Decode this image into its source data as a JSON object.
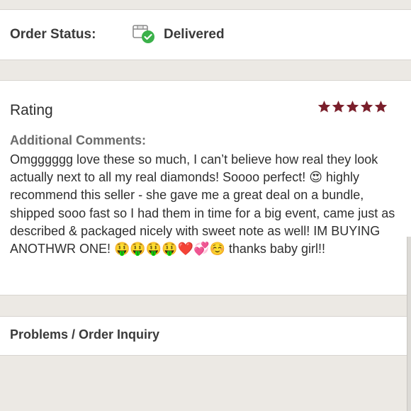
{
  "order_status": {
    "label": "Order Status:",
    "value": "Delivered",
    "icon": "package-delivered-icon",
    "check_color": "#3bb14a"
  },
  "rating": {
    "label": "Rating",
    "stars": 5,
    "star_color": "#7a1f2b"
  },
  "comments": {
    "label": "Additional Comments:",
    "text": "Omgggggg love these so much, I can’t believe how real they look actually next to all my real diamonds! Soooo perfect! 😍 highly recommend this seller - she gave me a great deal on a bundle, shipped sooo fast so I had them in time for a big event, came just as described & packaged nicely with sweet note as well! IM BUYING ANOTHWR ONE! 🤑🤑🤑🤑❤️💞☺️ thanks baby girl!!"
  },
  "problems": {
    "label": "Problems / Order Inquiry"
  }
}
